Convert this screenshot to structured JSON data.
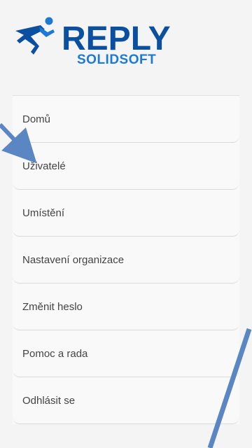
{
  "logo": {
    "brand": "REPLY",
    "sub": "SOLIDSOFT"
  },
  "menu": {
    "items": [
      {
        "label": "Domů"
      },
      {
        "label": "Uživatelé"
      },
      {
        "label": "Umístění"
      },
      {
        "label": "Nastavení organizace"
      },
      {
        "label": "Změnit heslo"
      },
      {
        "label": "Pomoc a rada"
      },
      {
        "label": "Odhlásit se"
      }
    ]
  },
  "colors": {
    "brand_dark": "#0b4fa0",
    "brand_light": "#1c7ad3",
    "annotation_arrow": "#5b86c4",
    "menu_text": "#444444"
  },
  "icons": [
    "runner-logo-icon",
    "annotation-arrow-icon"
  ]
}
